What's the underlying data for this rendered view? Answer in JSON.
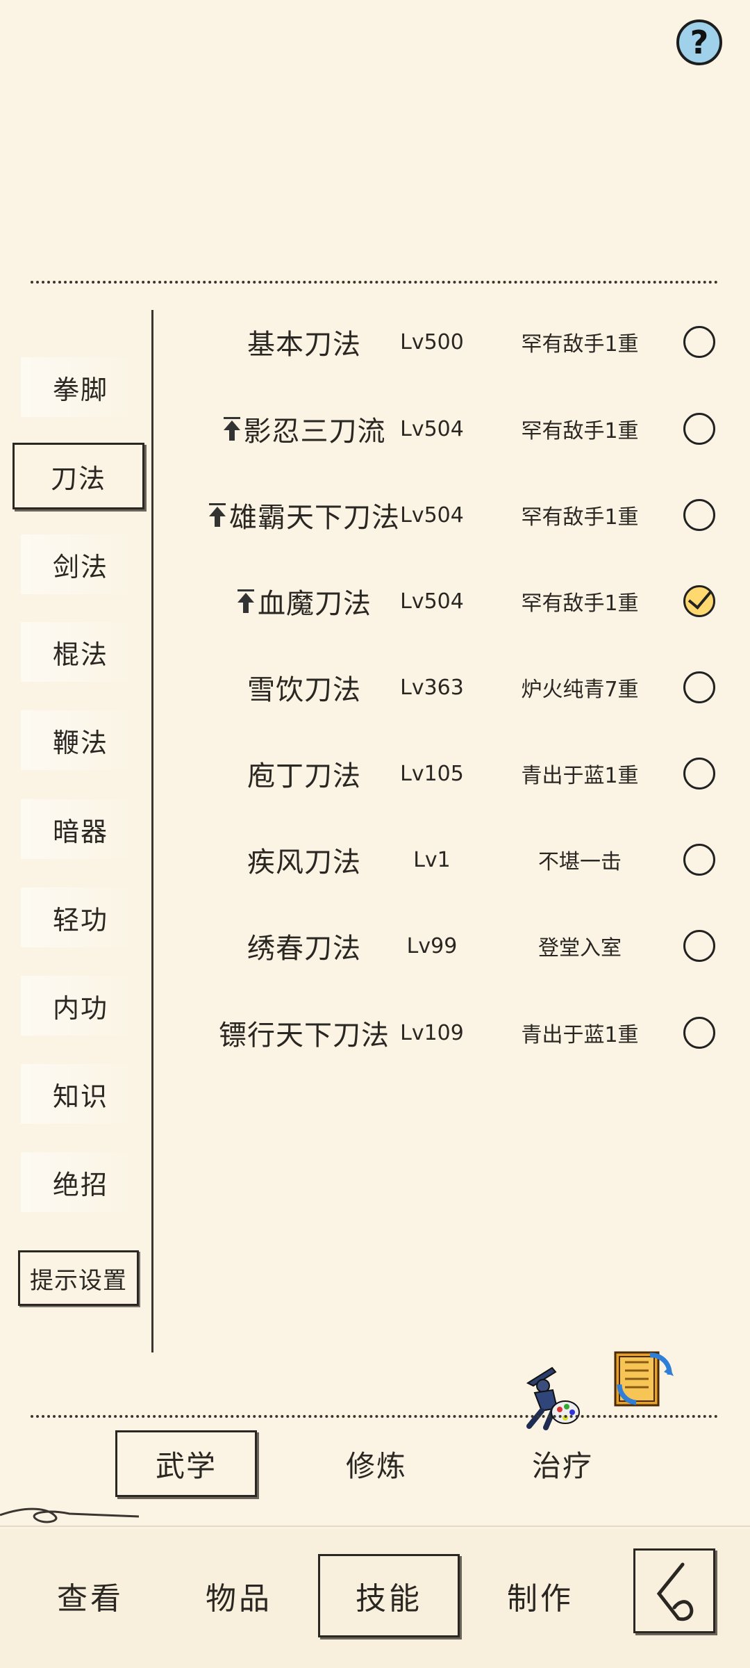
{
  "help": {
    "label": "?"
  },
  "categories": [
    {
      "label": "拳脚",
      "active": false
    },
    {
      "label": "刀法",
      "active": true
    },
    {
      "label": "剑法",
      "active": false
    },
    {
      "label": "棍法",
      "active": false
    },
    {
      "label": "鞭法",
      "active": false
    },
    {
      "label": "暗器",
      "active": false
    },
    {
      "label": "轻功",
      "active": false
    },
    {
      "label": "内功",
      "active": false
    },
    {
      "label": "知识",
      "active": false
    },
    {
      "label": "绝招",
      "active": false
    }
  ],
  "tips_button": {
    "label": "提示设置"
  },
  "skills": [
    {
      "name": "基本刀法",
      "level": "Lv500",
      "rank": "罕有敌手1重",
      "upgrade": false,
      "selected": false
    },
    {
      "name": "影忍三刀流",
      "level": "Lv504",
      "rank": "罕有敌手1重",
      "upgrade": true,
      "selected": false
    },
    {
      "name": "雄霸天下刀法",
      "level": "Lv504",
      "rank": "罕有敌手1重",
      "upgrade": true,
      "selected": false
    },
    {
      "name": "血魔刀法",
      "level": "Lv504",
      "rank": "罕有敌手1重",
      "upgrade": true,
      "selected": true
    },
    {
      "name": "雪饮刀法",
      "level": "Lv363",
      "rank": "炉火纯青7重",
      "upgrade": false,
      "selected": false
    },
    {
      "name": "庖丁刀法",
      "level": "Lv105",
      "rank": "青出于蓝1重",
      "upgrade": false,
      "selected": false
    },
    {
      "name": "疾风刀法",
      "level": "Lv1",
      "rank": "不堪一击",
      "upgrade": false,
      "selected": false
    },
    {
      "name": "绣春刀法",
      "level": "Lv99",
      "rank": "登堂入室",
      "upgrade": false,
      "selected": false
    },
    {
      "name": "镖行天下刀法",
      "level": "Lv109",
      "rank": "青出于蓝1重",
      "upgrade": false,
      "selected": false
    }
  ],
  "sub_tabs": [
    {
      "label": "武学",
      "active": true
    },
    {
      "label": "修炼",
      "active": false
    },
    {
      "label": "治疗",
      "active": false
    }
  ],
  "bottom_nav": [
    {
      "label": "查看",
      "active": false
    },
    {
      "label": "物品",
      "active": false
    },
    {
      "label": "技能",
      "active": true
    },
    {
      "label": "制作",
      "active": false
    }
  ],
  "icons": {
    "help": "question-icon",
    "upgrade": "arrow-up-icon",
    "checked": "checkmark-icon",
    "skin": "ninja-palette-icon",
    "switch": "book-swap-icon",
    "back": "back-arrow-icon"
  },
  "colors": {
    "background": "#fbf4e4",
    "help_bg": "#9fd2ea",
    "check_fill": "#ffd970",
    "ink": "#2a2622"
  }
}
